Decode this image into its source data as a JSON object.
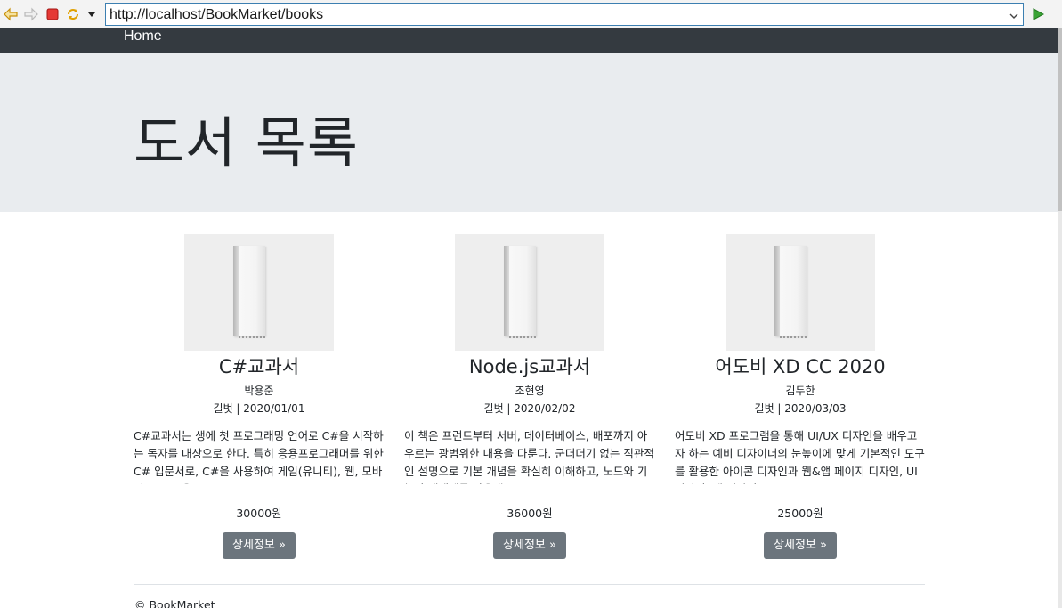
{
  "browser": {
    "url": "http://localhost/BookMarket/books",
    "icons": [
      "back-icon",
      "forward-icon",
      "stop-icon",
      "refresh-icon",
      "dropdown-arrow-icon",
      "go-icon"
    ]
  },
  "navbar": {
    "home_label": "Home"
  },
  "jumbotron": {
    "title": "도서 목록"
  },
  "books": [
    {
      "title": "C#교과서",
      "author": "박용준",
      "publisher_date": "길벗 | 2020/01/01",
      "description": "C#교과서는 생에 첫 프로그래밍 언어로 C#을 시작하는 독자를 대상으로 한다. 특히 응용프로그래머를 위한 C# 입문서로, C#을 사용하여 게임(유니티), 웹, 모바일, IoT 등을...",
      "price": "30000원",
      "button_label": "상세정보 »"
    },
    {
      "title": "Node.js교과서",
      "author": "조현영",
      "publisher_date": "길벗 | 2020/02/02",
      "description": "이 책은 프런트부터 서버, 데이터베이스, 배포까지 아우르는 광범위한 내용을 다룬다. 군더더기 없는 직관적인 설명으로 기본 개념을 확실히 이해하고, 노드와 기능과 생태계를 사용해 보...",
      "price": "36000원",
      "button_label": "상세정보 »"
    },
    {
      "title": "어도비 XD CC 2020",
      "author": "김두한",
      "publisher_date": "길벗 | 2020/03/03",
      "description": "어도비 XD 프로그램을 통해 UI/UX 디자인을 배우고자 하는 예비 디자이너의 눈높이에 맞게 기본적인 도구를 활용한 아이콘 디자인과 웹&앱 페이지 디자인, UI 디자인, 앱 디자인...",
      "price": "25000원",
      "button_label": "상세정보 »"
    }
  ],
  "footer": {
    "text": "© BookMarket"
  },
  "colors": {
    "navbar": "#343a40",
    "jumbotron": "#e9ecef",
    "button": "#6c757d",
    "url_border": "#3c7fb1"
  }
}
